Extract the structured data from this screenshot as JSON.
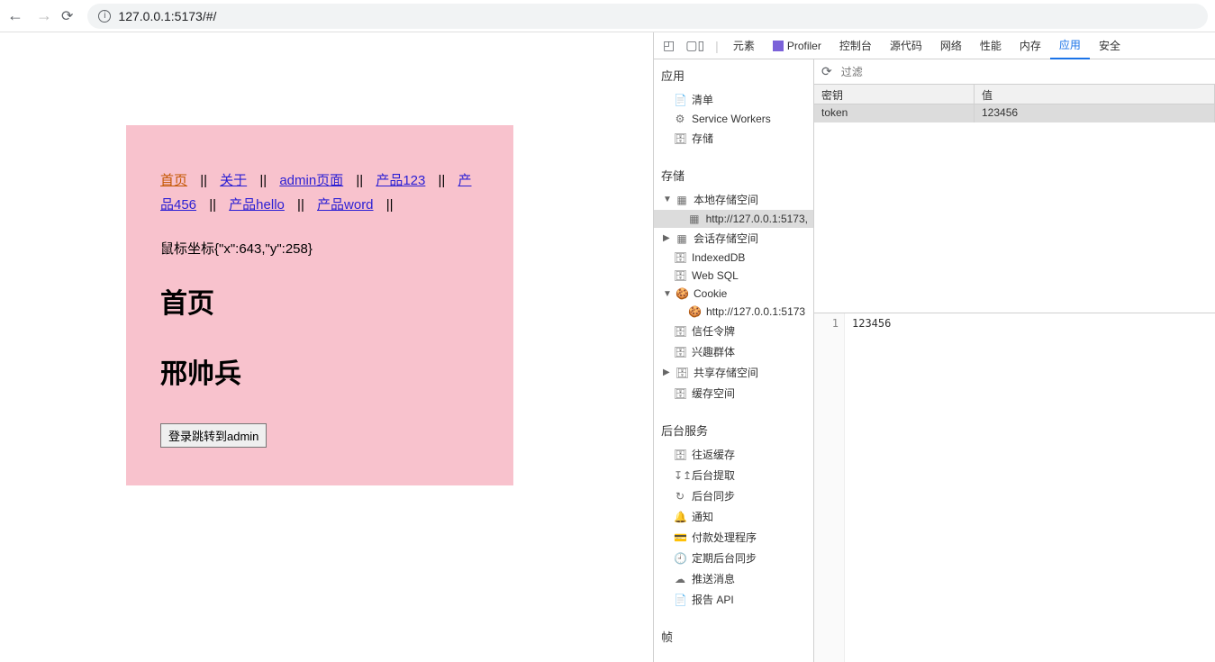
{
  "browser": {
    "url": "127.0.0.1:5173/#/"
  },
  "page": {
    "links": {
      "home": "首页",
      "about": "关于",
      "admin": "admin页面",
      "p123": "产品123",
      "p456": "产品456",
      "phello": "产品hello",
      "pword": "产品word"
    },
    "sep": "||",
    "coords_label": "鼠标坐标{\"x\":643,\"y\":258}",
    "h1": "首页",
    "h2": "邢帅兵",
    "login_btn": "登录跳转到admin"
  },
  "devtools": {
    "tabs": {
      "elements": "元素",
      "profiler": "Profiler",
      "console": "控制台",
      "sources": "源代码",
      "network": "网络",
      "performance": "性能",
      "memory": "内存",
      "application": "应用",
      "security": "安全"
    },
    "filter_placeholder": "过滤",
    "sidebar": {
      "app_title": "应用",
      "manifest": "清单",
      "service_workers": "Service Workers",
      "storage_overview": "存储",
      "storage_title": "存储",
      "local_storage": "本地存储空间",
      "local_storage_item": "http://127.0.0.1:5173,",
      "session_storage": "会话存储空间",
      "indexeddb": "IndexedDB",
      "websql": "Web SQL",
      "cookie": "Cookie",
      "cookie_item": "http://127.0.0.1:5173",
      "trust_tokens": "信任令牌",
      "interest_groups": "兴趣群体",
      "shared_storage": "共享存储空间",
      "cache_storage": "缓存空间",
      "bg_title": "后台服务",
      "bfcache": "往返缓存",
      "bg_fetch": "后台提取",
      "bg_sync": "后台同步",
      "notifications": "通知",
      "payment": "付款处理程序",
      "periodic_sync": "定期后台同步",
      "push": "推送消息",
      "reporting": "报告 API",
      "frame_title": "帧"
    },
    "table": {
      "key_header": "密钥",
      "val_header": "值",
      "row_key": "token",
      "row_val": "123456"
    },
    "viewer": {
      "line": "1",
      "value": "123456"
    }
  }
}
